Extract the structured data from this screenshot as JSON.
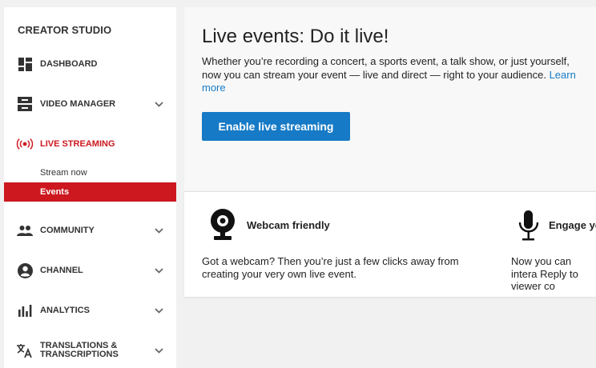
{
  "sidebar": {
    "brand": "CREATOR STUDIO",
    "items": [
      {
        "label": "DASHBOARD",
        "icon": "dashboard-icon"
      },
      {
        "label": "VIDEO MANAGER",
        "icon": "video-manager-icon"
      },
      {
        "label": "LIVE STREAMING",
        "icon": "live-streaming-icon",
        "active": true
      },
      {
        "label": "COMMUNITY",
        "icon": "community-icon"
      },
      {
        "label": "CHANNEL",
        "icon": "channel-icon"
      },
      {
        "label": "ANALYTICS",
        "icon": "analytics-icon"
      },
      {
        "label_line1": "TRANSLATIONS &",
        "label_line2": "TRANSCRIPTIONS",
        "icon": "translate-icon"
      }
    ],
    "live_sub_items": [
      {
        "label": "Stream now"
      },
      {
        "label": "Events",
        "selected": true
      }
    ]
  },
  "hero": {
    "title": "Live events: Do it live!",
    "description": "Whether you’re recording a concert, a sports event, a talk show, or just yourself, now you can stream your event — live and direct — right to your audience.",
    "learn_more": "Learn more",
    "button_label": "Enable live streaming"
  },
  "features": [
    {
      "icon": "webcam-icon",
      "title": "Webcam friendly",
      "description": "Got a webcam? Then you’re just a few clicks away from creating your very own live event."
    },
    {
      "icon": "microphone-icon",
      "title": "Engage yo",
      "description": "Now you can intera Reply to viewer co"
    }
  ],
  "colors": {
    "accent_red": "#cc181e",
    "primary_blue": "#167ac6",
    "page_bg": "#f1f1f1"
  }
}
